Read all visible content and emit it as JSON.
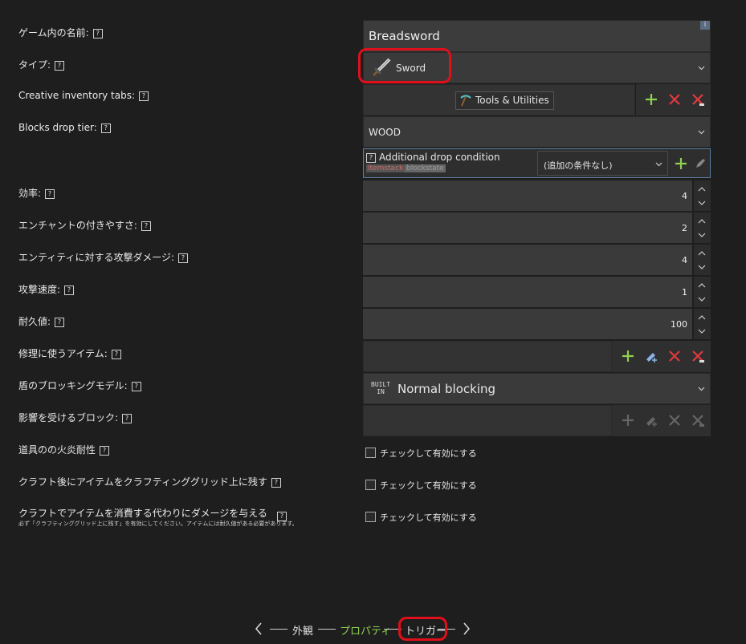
{
  "labels": {
    "name": "ゲーム内の名前:",
    "type": "タイプ:",
    "creative_tabs": "Creative inventory tabs:",
    "drop_tier": "Blocks drop tier:",
    "efficiency": "効率:",
    "enchantability": "エンチャントの付きやすさ:",
    "damage": "エンティティに対する攻撃ダメージ:",
    "attack_speed": "攻撃速度:",
    "durability": "耐久値:",
    "repair_items": "修理に使うアイテム:",
    "shield_model": "盾のブロッキングモデル:",
    "affected_blocks": "影響を受けるブロック:",
    "fire_resistance": "道具のの火炎耐性",
    "keep_after_craft": "クラフト後にアイテムをクラフティンググリッド上に残す",
    "damage_on_craft": "クラフトでアイテムを消費する代わりにダメージを与える",
    "damage_on_craft_note": "必ず「クラフティンググリッド上に残す」を有効にしてください。アイテムには耐久値がある必要があります。",
    "help_mark": "?"
  },
  "fields": {
    "name_value": "Breadsword",
    "info_mark": "i",
    "type_value": "Sword",
    "creative_tab_value": "Tools & Utilities",
    "drop_tier_value": "WOOD",
    "drop_condition_title": "Additional drop condition",
    "drop_condition_tag1": "itemstack",
    "drop_condition_tag2": "blockstate",
    "drop_condition_value": "(追加の条件なし)",
    "efficiency": "4",
    "enchantability": "2",
    "damage": "4",
    "attack_speed": "1",
    "durability": "100",
    "builtin_top": "BUILT",
    "builtin_bottom": "IN",
    "shield_model_value": "Normal blocking",
    "checkbox_label": "チェックして有効にする"
  },
  "nav": {
    "prev": "外観",
    "current": "プロパティ",
    "next": "トリガー"
  },
  "colors": {
    "accent_green": "#8fd14f",
    "danger_red": "#e0393e",
    "highlight_ring": "#e0101a"
  }
}
